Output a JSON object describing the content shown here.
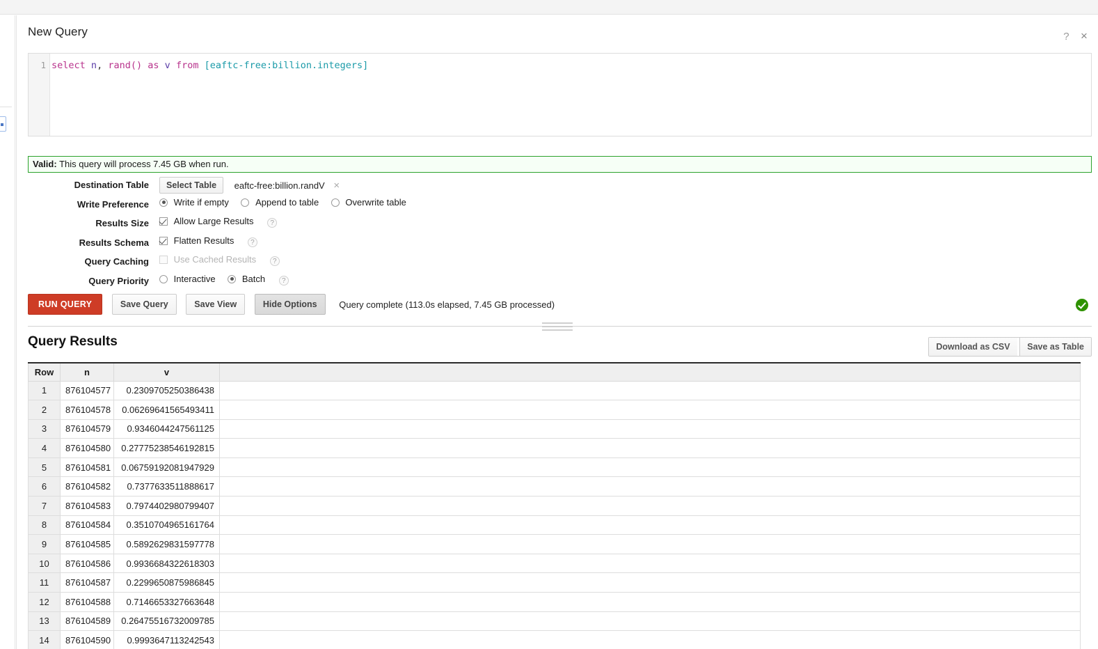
{
  "window": {
    "title": "New Query",
    "help_icon": "?",
    "close_icon": "×"
  },
  "editor": {
    "line_number": "1",
    "query_full": "select n, rand() as v from [eaftc-free:billion.integers]",
    "tokens": {
      "kw_select": "select",
      "id_n": "n",
      "comma": ",",
      "fn_rand": "rand()",
      "kw_as": "as",
      "id_v": "v",
      "kw_from": "from",
      "table_ref": "[eaftc-free:billion.integers]"
    }
  },
  "validity": {
    "prefix": "Valid:",
    "message": "This query will process 7.45 GB when run."
  },
  "options": {
    "destination": {
      "label": "Destination Table",
      "select_button": "Select Table",
      "table_name": "eaftc-free:billion.randV",
      "clear_icon": "×"
    },
    "write_preference": {
      "label": "Write Preference",
      "choices": [
        {
          "label": "Write if empty",
          "selected": true
        },
        {
          "label": "Append to table",
          "selected": false
        },
        {
          "label": "Overwrite table",
          "selected": false
        }
      ]
    },
    "results_size": {
      "label": "Results Size",
      "checkbox_label": "Allow Large Results",
      "checked": true,
      "help": "?"
    },
    "results_schema": {
      "label": "Results Schema",
      "checkbox_label": "Flatten Results",
      "checked": true,
      "help": "?"
    },
    "query_caching": {
      "label": "Query Caching",
      "checkbox_label": "Use Cached Results",
      "checked": false,
      "disabled": true,
      "help": "?"
    },
    "query_priority": {
      "label": "Query Priority",
      "choices": [
        {
          "label": "Interactive",
          "selected": false
        },
        {
          "label": "Batch",
          "selected": true
        }
      ],
      "help": "?"
    }
  },
  "actions": {
    "run_query": "RUN QUERY",
    "save_query": "Save Query",
    "save_view": "Save View",
    "hide_options": "Hide Options",
    "status": "Query complete (113.0s elapsed, 7.45 GB processed)",
    "status_icon": "check-circle"
  },
  "results": {
    "title": "Query Results",
    "download_csv": "Download as CSV",
    "save_as_table": "Save as Table",
    "columns": [
      "Row",
      "n",
      "v"
    ],
    "rows": [
      {
        "row": "1",
        "n": "876104577",
        "v": "0.2309705250386438"
      },
      {
        "row": "2",
        "n": "876104578",
        "v": "0.06269641565493411"
      },
      {
        "row": "3",
        "n": "876104579",
        "v": "0.9346044247561125"
      },
      {
        "row": "4",
        "n": "876104580",
        "v": "0.27775238546192815"
      },
      {
        "row": "5",
        "n": "876104581",
        "v": "0.06759192081947929"
      },
      {
        "row": "6",
        "n": "876104582",
        "v": "0.7377633511888617"
      },
      {
        "row": "7",
        "n": "876104583",
        "v": "0.7974402980799407"
      },
      {
        "row": "8",
        "n": "876104584",
        "v": "0.3510704965161764"
      },
      {
        "row": "9",
        "n": "876104585",
        "v": "0.5892629831597778"
      },
      {
        "row": "10",
        "n": "876104586",
        "v": "0.9936684322618303"
      },
      {
        "row": "11",
        "n": "876104587",
        "v": "0.2299650875986845"
      },
      {
        "row": "12",
        "n": "876104588",
        "v": "0.7146653327663648"
      },
      {
        "row": "13",
        "n": "876104589",
        "v": "0.26475516732009785"
      },
      {
        "row": "14",
        "n": "876104590",
        "v": "0.9993647113242543"
      }
    ]
  },
  "colors": {
    "run_button": "#ce3c26",
    "valid_border": "#2ba22b",
    "status_check": "#2e9200",
    "sql_keyword": "#b8338c",
    "sql_identifier": "#5b3ea8",
    "sql_table": "#1a9aa8"
  }
}
